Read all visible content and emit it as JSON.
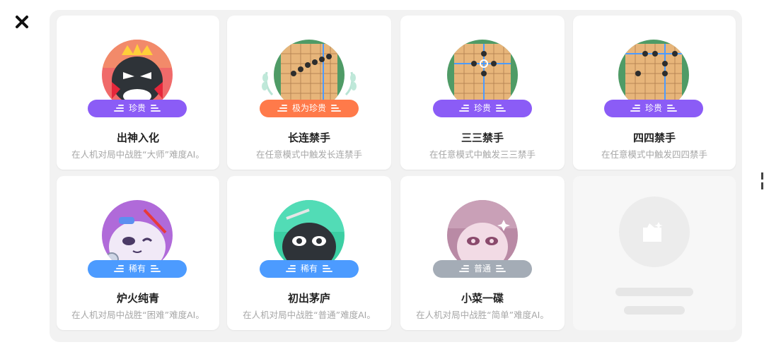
{
  "colors": {
    "rare_purple": "#8B5CF6",
    "very_rare_orange": "#FF7A4A",
    "uncommon_blue": "#4C9BFF",
    "common_gray": "#A4ACB6",
    "title_text": "#222222",
    "desc_text": "#A7A7A7"
  },
  "achievements": [
    {
      "title": "出神入化",
      "desc": "在人机对局中战胜“大师”难度AI。",
      "badge": "珍贵",
      "badge_color": "#8B5CF6",
      "icon": "king-robot-icon"
    },
    {
      "title": "长连禁手",
      "desc": "在任意模式中触发长连禁手",
      "badge": "极为珍贵",
      "badge_color": "#FF7A4A",
      "icon": "go-board-laurel-icon"
    },
    {
      "title": "三三禁手",
      "desc": "在任意模式中触发三三禁手",
      "badge": "珍贵",
      "badge_color": "#8B5CF6",
      "icon": "go-board-33-icon"
    },
    {
      "title": "四四禁手",
      "desc": "在任意模式中触发四四禁手",
      "badge": "珍贵",
      "badge_color": "#8B5CF6",
      "icon": "go-board-44-icon"
    },
    {
      "title": "炉火纯青",
      "desc": "在人机对局中战胜“困难”难度AI。",
      "badge": "稀有",
      "badge_color": "#4C9BFF",
      "icon": "winking-robot-icon"
    },
    {
      "title": "初出茅庐",
      "desc": "在人机对局中战胜“普通”难度AI。",
      "badge": "稀有",
      "badge_color": "#4C9BFF",
      "icon": "sword-robot-icon"
    },
    {
      "title": "小菜一碟",
      "desc": "在人机对局中战胜“简单”难度AI。",
      "badge": "普通",
      "badge_color": "#A4ACB6",
      "icon": "pink-robot-icon"
    }
  ],
  "locked_card": {
    "icon": "locked-achievement-icon"
  }
}
